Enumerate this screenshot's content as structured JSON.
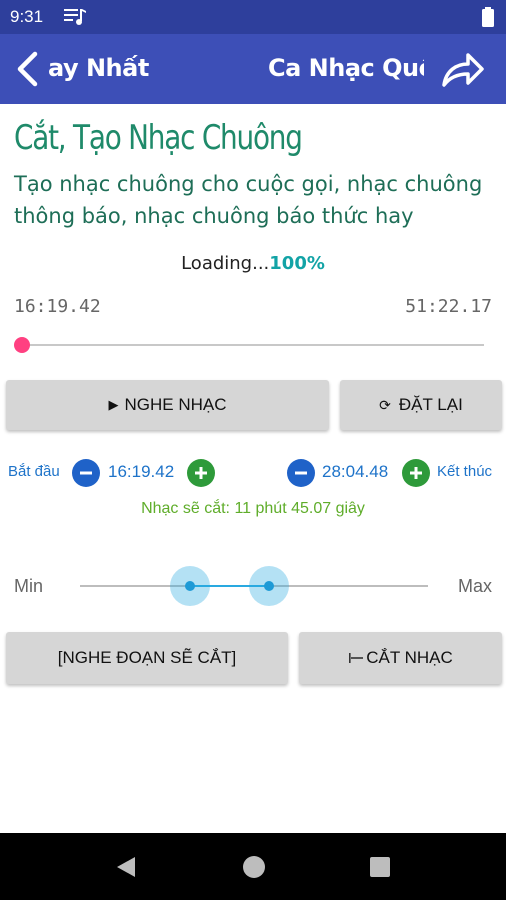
{
  "status": {
    "time": "9:31"
  },
  "app_bar": {
    "title_left": "ay Nhất",
    "title_right": "Ca Nhạc Quê Hương"
  },
  "page": {
    "heading": "Cắt, Tạo Nhạc Chuông",
    "description": "Tạo nhạc chuông cho cuộc gọi, nhạc chuông thông báo, nhạc chuông báo thức hay"
  },
  "loading": {
    "text": "Loading...",
    "percent": "100%"
  },
  "player": {
    "current_time": "16:19.42",
    "total_time": "51:22.17",
    "progress": 0.0
  },
  "buttons": {
    "play": "NGHE NHẠC",
    "reset": "ĐẶT LẠI",
    "preview": "[NGHE ĐOẠN SẼ CẮT]",
    "cut": "CẮT NHẠC"
  },
  "range": {
    "start_label": "Bắt đầu",
    "start_time": "16:19.42",
    "end_time": "28:04.48",
    "end_label": "Kết thúc",
    "cut_info": "Nhạc sẽ cắt: 11 phút 45.07 giây",
    "min_label": "Min",
    "max_label": "Max"
  },
  "colors": {
    "status_bar": "#2e3f9c",
    "app_bar": "#3d4fb7",
    "heading": "#1f8a6a",
    "accent_pink": "#ff4081",
    "range_blue": "#29a9e0",
    "minus_blue": "#1f62c8",
    "plus_green": "#2e9a3a"
  },
  "icons": {
    "back": "chevron-left-icon",
    "share": "share-icon",
    "play": "play-icon",
    "reset": "refresh-icon",
    "cut": "scissors-icon"
  }
}
